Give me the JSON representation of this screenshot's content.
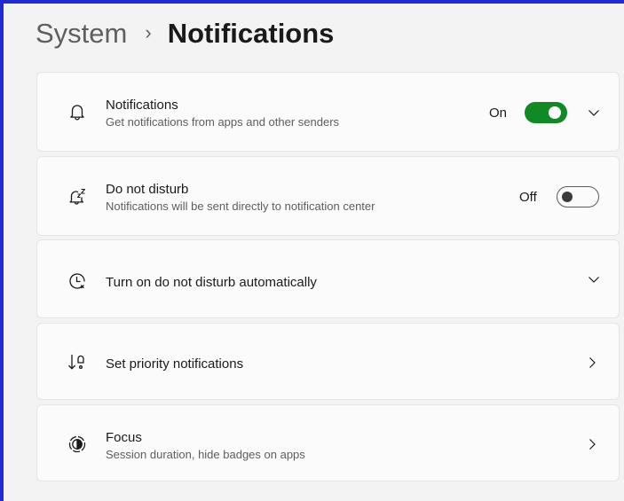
{
  "breadcrumb": {
    "parent": "System",
    "separator": "›",
    "current": "Notifications"
  },
  "colors": {
    "accent": "#0f8a25",
    "frame": "#1f2bd6"
  },
  "cards": {
    "notifications": {
      "icon": "bell-icon",
      "title": "Notifications",
      "subtitle": "Get notifications from apps and other senders",
      "state": "On",
      "toggle_on": true
    },
    "dnd": {
      "icon": "bell-snooze-icon",
      "title": "Do not disturb",
      "subtitle": "Notifications will be sent directly to notification center",
      "state": "Off",
      "toggle_on": false
    },
    "dnd_auto": {
      "icon": "clock-icon",
      "title": "Turn on do not disturb automatically"
    },
    "priority": {
      "icon": "priority-icon",
      "title": "Set priority notifications"
    },
    "focus": {
      "icon": "focus-icon",
      "title": "Focus",
      "subtitle": "Session duration, hide badges on apps"
    }
  }
}
